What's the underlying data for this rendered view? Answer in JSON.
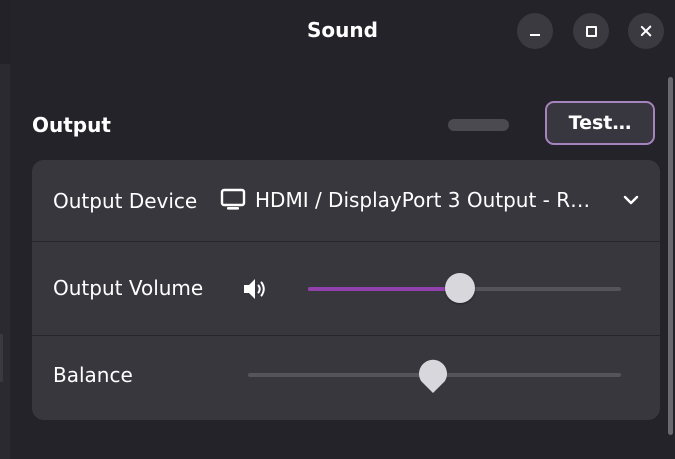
{
  "window": {
    "title": "Sound"
  },
  "output": {
    "section_title": "Output",
    "test_button_label": "Test…",
    "device": {
      "label": "Output Device",
      "selected": "HDMI / DisplayPort 3 Output - R…"
    },
    "volume": {
      "label": "Output Volume",
      "level": 0.487
    },
    "balance": {
      "label": "Balance",
      "level": 0.496
    }
  },
  "colors": {
    "accent": "#9141ac",
    "focus_ring": "#a583bd",
    "background": "#242329",
    "card": "#38373e"
  },
  "icons": {
    "device": "monitor-icon",
    "dropdown": "chevron-down-icon",
    "volume": "speaker-icon",
    "minimize": "minimize-icon",
    "maximize": "maximize-icon",
    "close": "close-icon"
  }
}
